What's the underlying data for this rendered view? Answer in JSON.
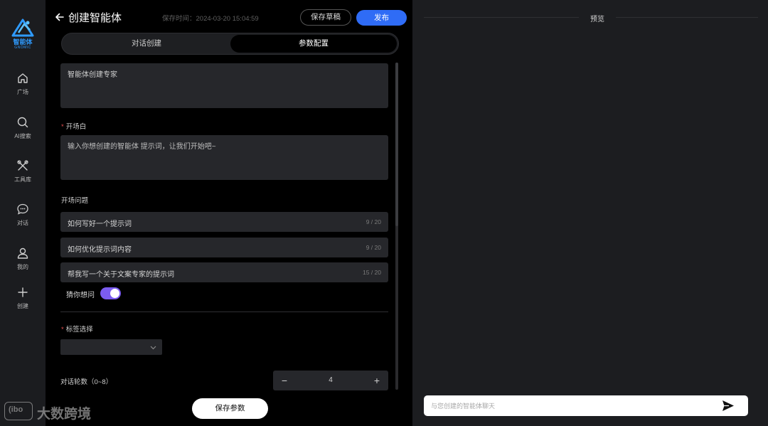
{
  "nav": {
    "brand": "智能体",
    "brand_sub": "GNOMIC",
    "items": [
      {
        "icon": "home-icon",
        "label": "广场"
      },
      {
        "icon": "search-icon",
        "label": "AI搜索"
      },
      {
        "icon": "tools-icon",
        "label": "工具库"
      },
      {
        "icon": "chat-icon",
        "label": "对话"
      },
      {
        "icon": "user-icon",
        "label": "我的"
      },
      {
        "icon": "plus-icon",
        "label": "创建"
      }
    ]
  },
  "header": {
    "title": "创建智能体",
    "save_time": "保存时间：2024-03-20 15:04:59",
    "draft_label": "保存草稿",
    "publish_label": "发布"
  },
  "tabs": [
    "对话创建",
    "参数配置"
  ],
  "active_tab": "参数配置",
  "form": {
    "description_value": "智能体创建专家",
    "opening_label": "开场白",
    "opening_placeholder": "输入你想创建的智能体 提示词，让我们开始吧~",
    "questions_label": "开场问题",
    "questions": [
      {
        "text": "如何写好一个提示词",
        "count": "9 / 20"
      },
      {
        "text": "如何优化提示词内容",
        "count": "9 / 20"
      },
      {
        "text": "帮我写一个关于文案专家的提示词",
        "count": "15 / 20"
      }
    ],
    "guess_label": "猜你想问",
    "guess_enabled": true,
    "tag_label": "标签选择",
    "tag_value": "",
    "rounds_label": "对话轮数（0~8）",
    "rounds_value": "4",
    "minus": "−",
    "plus": "+",
    "save_label": "保存参数"
  },
  "watermark": {
    "icon_text": "(ibo",
    "text": "大数跨境"
  },
  "preview": {
    "title": "预览",
    "input_placeholder": "与您创建的智能体聊天"
  },
  "colors": {
    "accent": "#2f6cf6",
    "toggle": "#7b5cf0",
    "required": "#e34d4d",
    "brand": "#2f9bff"
  }
}
